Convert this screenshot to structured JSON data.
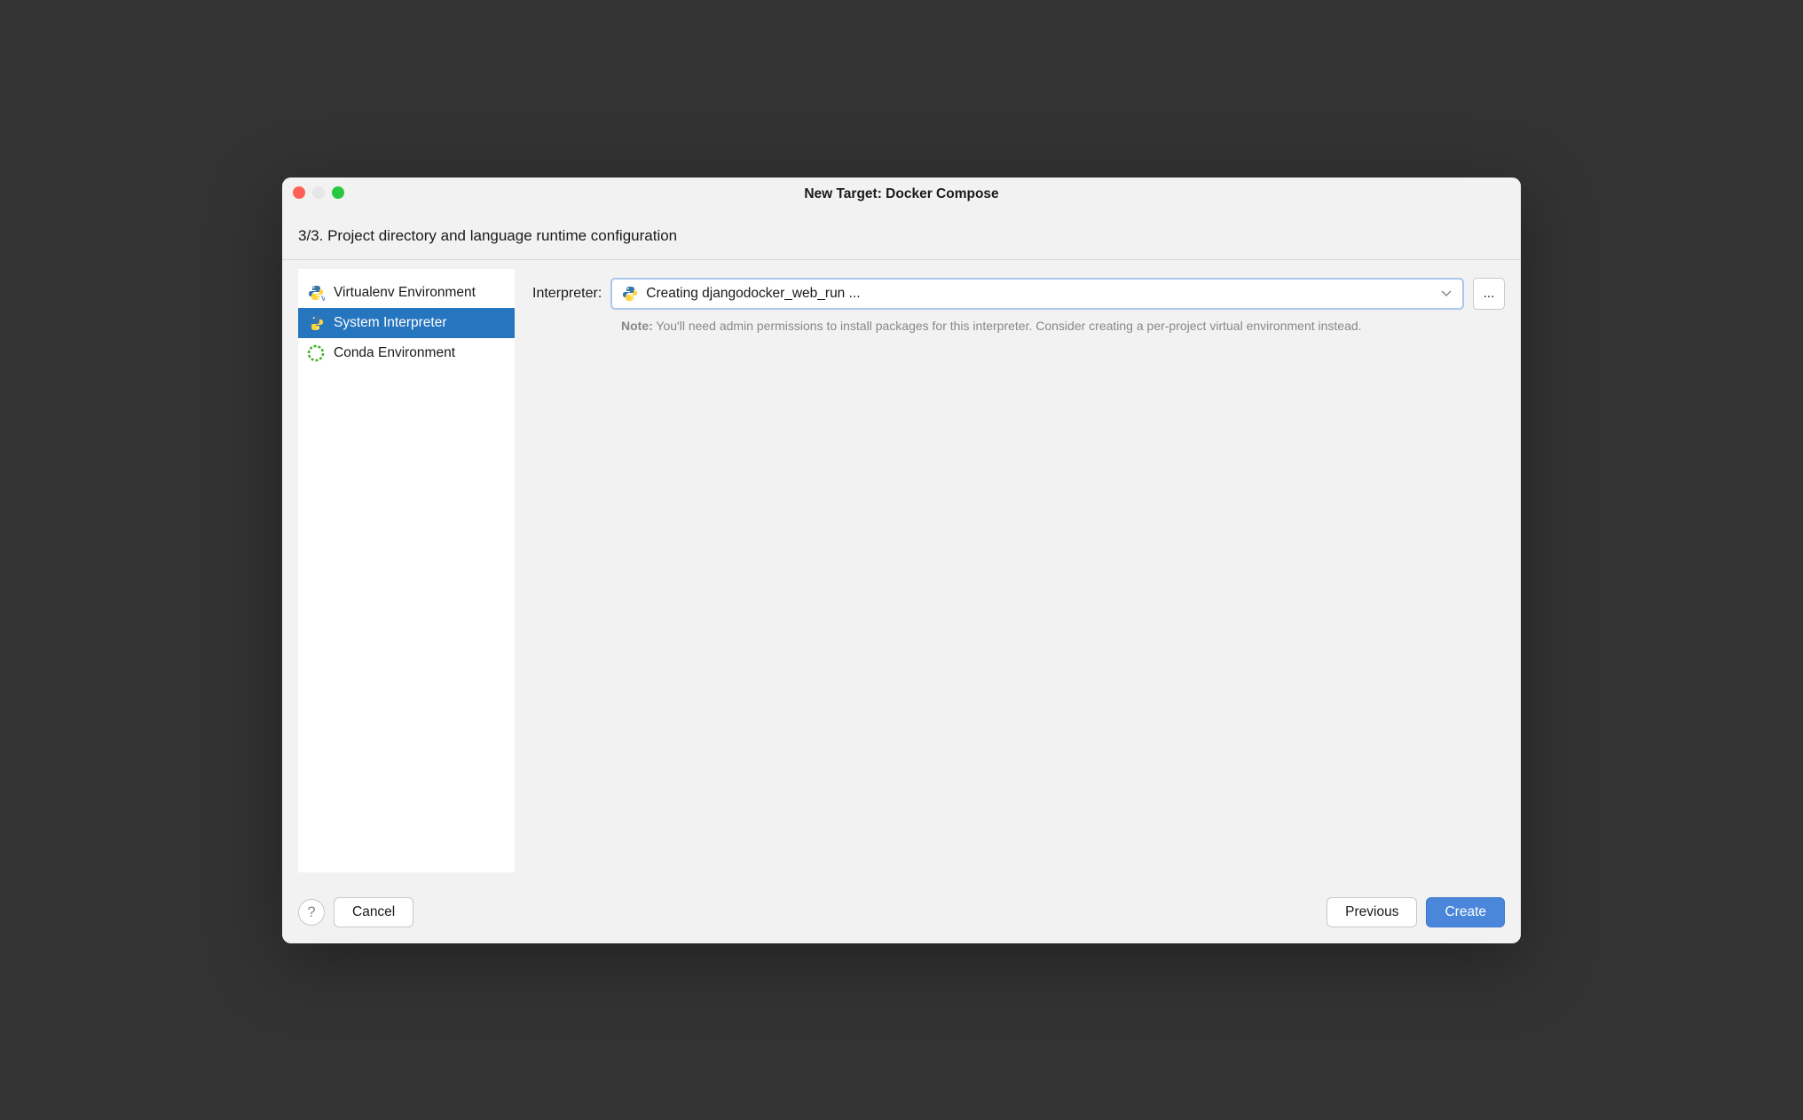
{
  "titlebar": {
    "title": "New Target: Docker Compose"
  },
  "stepHeader": "3/3. Project directory and language runtime configuration",
  "sidebar": {
    "items": [
      {
        "label": "Virtualenv Environment",
        "icon": "python-v-icon",
        "selected": false
      },
      {
        "label": "System Interpreter",
        "icon": "python-icon",
        "selected": true
      },
      {
        "label": "Conda Environment",
        "icon": "conda-icon",
        "selected": false
      }
    ]
  },
  "main": {
    "interpreter": {
      "label": "Interpreter:",
      "value": "Creating djangodocker_web_run ...",
      "browseLabel": "..."
    },
    "note": {
      "bold": "Note:",
      "text": " You'll need admin permissions to install packages for this interpreter. Consider creating a per-project virtual environment instead."
    }
  },
  "footer": {
    "help": "?",
    "cancel": "Cancel",
    "previous": "Previous",
    "create": "Create"
  }
}
